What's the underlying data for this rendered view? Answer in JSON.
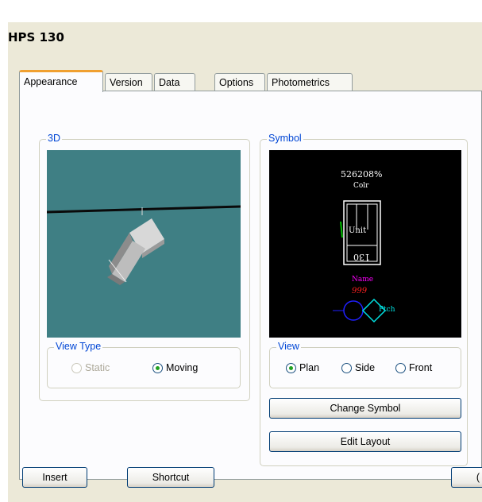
{
  "window": {
    "title": "HPS 130"
  },
  "tabs": [
    {
      "label": "Appearance",
      "active": true
    },
    {
      "label": "Version"
    },
    {
      "label": "Data"
    },
    {
      "label": "Options"
    },
    {
      "label": "Photometrics"
    }
  ],
  "group3d": {
    "legend": "3D"
  },
  "viewType": {
    "legend": "View Type",
    "options": [
      {
        "label": "Static",
        "checked": false,
        "disabled": true
      },
      {
        "label": "Moving",
        "checked": true,
        "disabled": false
      }
    ]
  },
  "symbol": {
    "legend": "Symbol",
    "preview": {
      "value": "526208%",
      "color_label": "Colr",
      "unit_label": "Unit",
      "number": "130",
      "name_label": "Name",
      "name_number": "999",
      "pitch_label": "Ptch",
      "colors": {
        "white": "#ffffff",
        "green": "#00c000",
        "magenta": "#ff00ff",
        "red": "#ff2020",
        "blue": "#2020ff",
        "cyan": "#00e0e0"
      }
    }
  },
  "view": {
    "legend": "View",
    "options": [
      {
        "label": "Plan",
        "checked": true
      },
      {
        "label": "Side",
        "checked": false
      },
      {
        "label": "Front",
        "checked": false
      }
    ]
  },
  "buttons": {
    "change_symbol": "Change Symbol",
    "edit_layout": "Edit Layout",
    "insert": "Insert",
    "shortcut": "Shortcut",
    "cut_off": "("
  }
}
